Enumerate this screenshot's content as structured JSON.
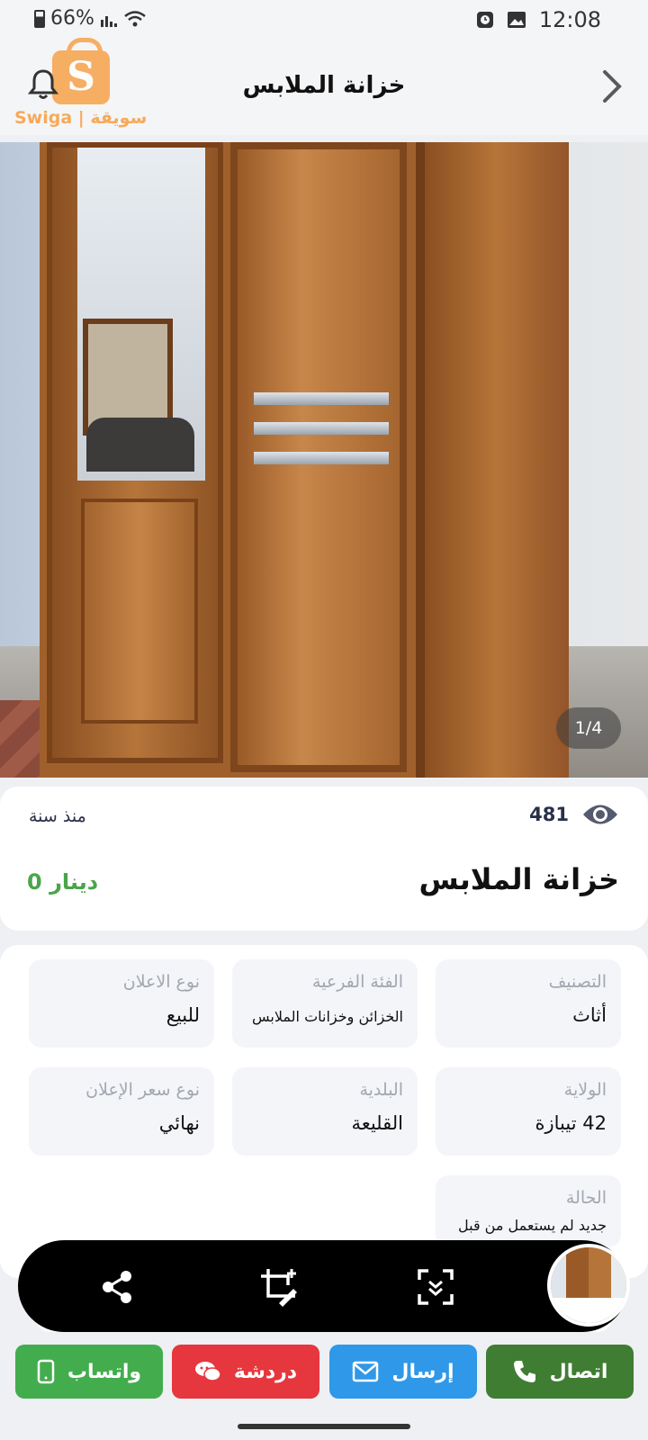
{
  "status_bar": {
    "battery": "66%",
    "time": "12:08"
  },
  "header": {
    "title": "خزانة الملابس",
    "logo_text": "Swiga | سويقة"
  },
  "gallery": {
    "counter": "1/4"
  },
  "listing": {
    "views": "481",
    "posted": "منذ سنة",
    "title": "خزانة الملابس",
    "price": "0 دينار"
  },
  "details": {
    "category_label": "التصنيف",
    "category_value": "أثاث",
    "subcategory_label": "الفئة الفرعية",
    "subcategory_value": "الخزائن وخزانات الملابس",
    "ad_type_label": "نوع الاعلان",
    "ad_type_value": "للبيع",
    "state_label": "الولاية",
    "state_value": "42 تيبازة",
    "municipality_label": "البلدية",
    "municipality_value": "القليعة",
    "price_type_label": "نوع سعر الإعلان",
    "price_type_value": "نهائي",
    "condition_label": "الحالة",
    "condition_value": "جديد لم يستعمل من قبل"
  },
  "actions": {
    "call": "اتصال",
    "send": "إرسال",
    "chat": "دردشة",
    "whatsapp": "واتساب"
  },
  "colors": {
    "call": "#3f7d33",
    "send": "#2f98e8",
    "chat": "#e5373d",
    "whatsapp": "#43ad4e",
    "price": "#4aa54a"
  },
  "icons": {
    "views": "eye-icon",
    "back": "chevron-right-icon",
    "notifications": "bell-icon",
    "share": "share-icon",
    "edit": "crop-edit-icon",
    "scroll_capture": "scroll-capture-icon"
  }
}
